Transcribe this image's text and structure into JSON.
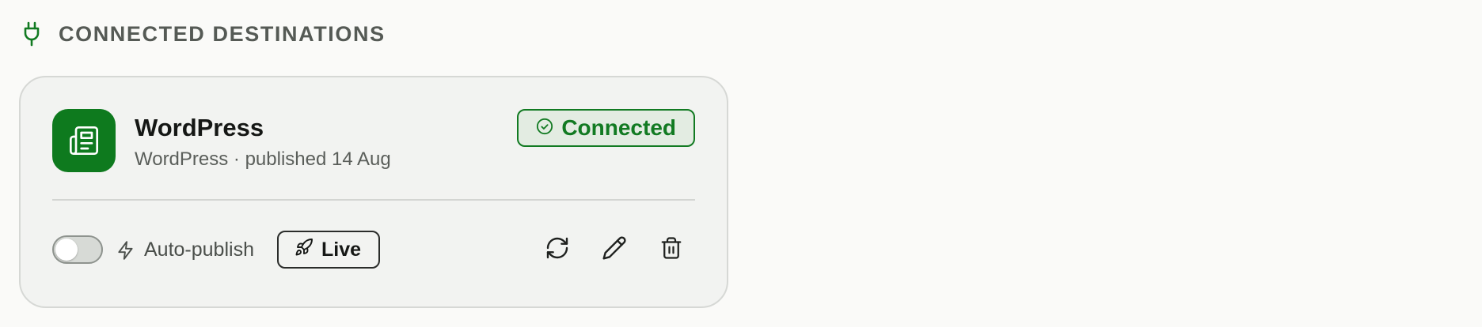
{
  "section": {
    "title": "CONNECTED DESTINATIONS",
    "icon": "plug-icon"
  },
  "destination": {
    "name": "WordPress",
    "meta": "WordPress · published 14 Aug",
    "icon": "newspaper-icon",
    "status_label": "Connected",
    "status_icon": "check-circle-icon",
    "auto_publish_label": "Auto-publish",
    "auto_publish_enabled": false,
    "live_label": "Live",
    "live_icon": "rocket-icon",
    "actions": {
      "refresh_icon": "refresh-icon",
      "edit_icon": "pencil-icon",
      "delete_icon": "trash-icon"
    }
  },
  "colors": {
    "brand": "#0e7a1e",
    "status_green": "#127a22",
    "card_bg": "#f2f3f1",
    "page_bg": "#fafaf8"
  }
}
